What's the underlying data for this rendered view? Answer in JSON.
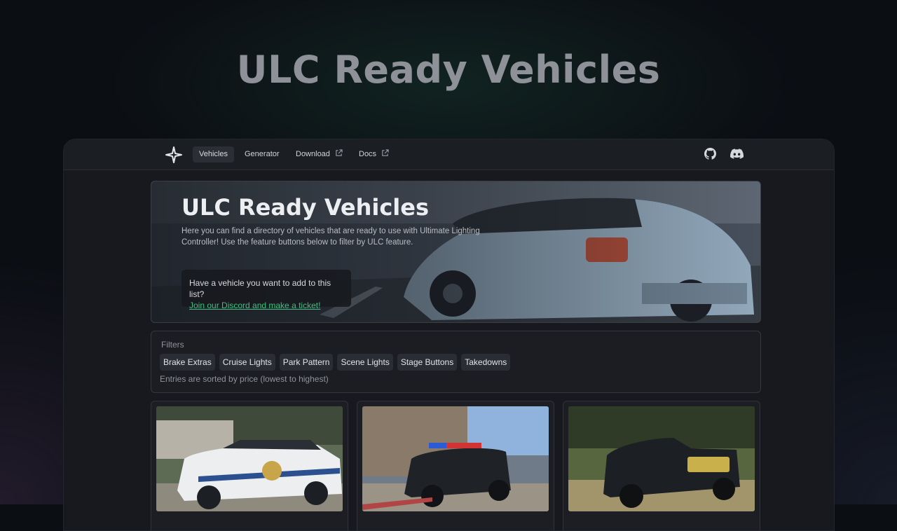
{
  "page": {
    "headline": "ULC Ready Vehicles"
  },
  "navbar": {
    "logo_icon": "sparkle-logo-icon",
    "items": [
      {
        "label": "Vehicles",
        "active": true,
        "external": false
      },
      {
        "label": "Generator",
        "active": false,
        "external": false
      },
      {
        "label": "Download",
        "active": false,
        "external": true
      },
      {
        "label": "Docs",
        "active": false,
        "external": true
      }
    ],
    "icons": [
      "github-icon",
      "discord-icon"
    ]
  },
  "banner": {
    "title": "ULC Ready Vehicles",
    "description": "Here you can find a directory of vehicles that are ready to use with Ultimate Lighting Controller! Use the feature buttons below to filter by ULC feature.",
    "callout_text": "Have a vehicle you want to add to this list?",
    "callout_link": "Join our Discord and make a ticket!",
    "link_color": "#3fbf7f"
  },
  "filters": {
    "label": "Filters",
    "chips": [
      "Brake Extras",
      "Cruise Lights",
      "Park Pattern",
      "Scene Lights",
      "Stage Buttons",
      "Takedowns"
    ],
    "sort_note": "Entries are sorted by price (lowest to highest)"
  },
  "cards": [
    {
      "image": "white-sheriff-suv-photo"
    },
    {
      "image": "black-police-suv-photo"
    },
    {
      "image": "black-pickup-truck-photo"
    }
  ]
}
